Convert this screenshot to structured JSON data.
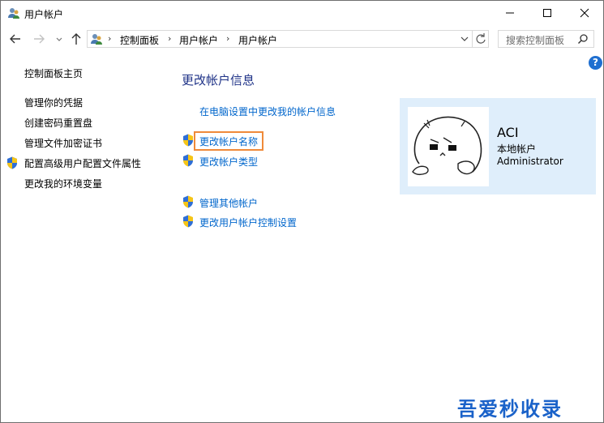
{
  "window": {
    "title": "用户帐户"
  },
  "address": {
    "crumbs": [
      "控制面板",
      "用户帐户",
      "用户帐户"
    ]
  },
  "search": {
    "placeholder": "搜索控制面板"
  },
  "help": {
    "label": "?"
  },
  "sidebar": {
    "items": [
      {
        "label": "控制面板主页",
        "icon": null
      },
      {
        "label": "管理你的凭据",
        "icon": null
      },
      {
        "label": "创建密码重置盘",
        "icon": null
      },
      {
        "label": "管理文件加密证书",
        "icon": null
      },
      {
        "label": "配置高级用户配置文件属性",
        "icon": "uac-shield-icon"
      },
      {
        "label": "更改我的环境变量",
        "icon": null
      }
    ]
  },
  "main": {
    "title": "更改帐户信息",
    "links": [
      {
        "label": "在电脑设置中更改我的帐户信息",
        "icon": null
      },
      {
        "label": "更改帐户名称",
        "icon": "uac-shield-icon",
        "highlighted": true
      },
      {
        "label": "更改帐户类型",
        "icon": "uac-shield-icon"
      },
      {
        "label": "管理其他帐户",
        "icon": "uac-shield-icon"
      },
      {
        "label": "更改用户帐户控制设置",
        "icon": "uac-shield-icon"
      }
    ]
  },
  "user": {
    "name": "ACI",
    "type": "本地帐户",
    "role": "Administrator"
  },
  "watermark": {
    "text": "吾爱秒收录"
  },
  "colors": {
    "link": "#0066cc",
    "title": "#1e3287",
    "highlight": "#ef8a3a",
    "card_bg": "#dfeefb",
    "watermark": "#1a62c9"
  }
}
